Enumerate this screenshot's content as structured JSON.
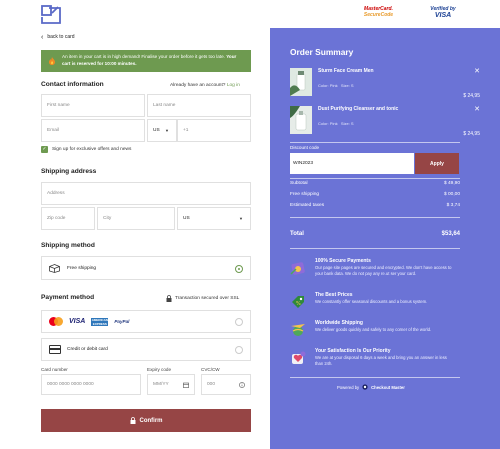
{
  "header": {
    "mastercard_line1": "MasterCard.",
    "mastercard_line2": "SecureCode",
    "visa_line1": "Verified by",
    "visa_line2": "VISA"
  },
  "checkout": {
    "back_label": "back to card",
    "alert_text": "An item in your cart is in high demand! Finalise your order before it gets too late.",
    "alert_bold": "Your cart is reserved for 10:00 minutes.",
    "contact_title": "Contact information",
    "account_prompt": "Already have an account?",
    "login_label": "Log in",
    "first_name_placeholder": "First name",
    "last_name_placeholder": "Last name",
    "email_placeholder": "Email",
    "country_code": "US",
    "phone_prefix": "+1",
    "signup_label": "Sign up for exclusive offers and news",
    "shipping_title": "Shipping address",
    "address_placeholder": "Address",
    "zip_placeholder": "Zip code",
    "city_placeholder": "City",
    "country_value": "US",
    "method_title": "Shipping method",
    "free_shipping_label": "Free shipping",
    "payment_title": "Payment method",
    "secured_label": "Transaction secured over SSL",
    "visa_text": "VISA",
    "amex_text": "AMERICAN EXPRESS",
    "paypal_text": "PayPal",
    "card_option_label": "Credit or debit card",
    "card_number_label": "Card number",
    "card_number_placeholder": "0000  0000  0000  0000",
    "expiry_label": "Expiry code",
    "expiry_placeholder": "MM/YY",
    "cvc_label": "CVC/CW",
    "cvc_placeholder": "000",
    "confirm_label": "Confirm"
  },
  "summary": {
    "title": "Order Summary",
    "items": [
      {
        "name": "Sturm Face Cream Men",
        "color": "Color: Pink",
        "size": "Size: S",
        "price": "$ 24,95"
      },
      {
        "name": "Dust Purifying Cleanser and tonic",
        "color": "Color: Pink",
        "size": "Size: S",
        "price": "$ 24,95"
      }
    ],
    "discount_label": "Discount code",
    "discount_value": "WIN2023",
    "apply_label": "Apply",
    "subtotal_label": "Subtotal",
    "subtotal_value": "$ 49,90",
    "shipping_label": "Free shipping",
    "shipping_value": "$ 00,00",
    "taxes_label": "Estimated taxes",
    "taxes_value": "$ 3,74",
    "total_label": "Total",
    "total_value": "$53,64",
    "features": [
      {
        "title": "100% Secure Payments",
        "desc": "Our page site pages are secured and encrypted. We don't have access to your bank data. We do not pay any re.ut ser your card."
      },
      {
        "title": "The Best Prices",
        "desc": "We constantly offer seasonal discounts and a bonus system."
      },
      {
        "title": "Worldwide Shipping",
        "desc": "We deliver goods quickly and safely to any corner of the world."
      },
      {
        "title": "Your Satisfaction Is Our Priority",
        "desc": "We are at your disposal 6 days a week and bring you an answer in less than 24h."
      }
    ],
    "powered_by": "Powered by",
    "powered_brand": "Checkout Master"
  },
  "colors": {
    "accent_green": "#6e9a50",
    "summary_bg": "#6b73d6",
    "button_red": "#964545"
  },
  "icons": [
    "logo-icon",
    "flame-icon",
    "truck-icon",
    "lock-icon",
    "card-icon",
    "calendar-icon",
    "info-icon",
    "close-icon"
  ]
}
